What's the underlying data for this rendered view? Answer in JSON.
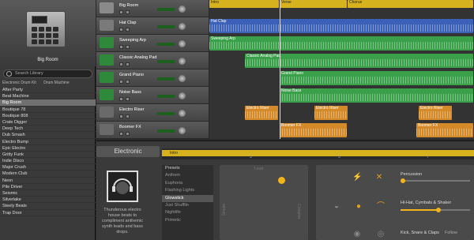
{
  "library": {
    "art_title": "Big Room",
    "search_placeholder": "Search Library",
    "crumbs": [
      "Electronic Drum Kit",
      "Drum Machine"
    ],
    "items": [
      "After Party",
      "Beat Machine",
      "Big Room",
      "Boutique 78",
      "Boutique 808",
      "Crate Digger",
      "Deep Tech",
      "Dub Smash",
      "Electro Bump",
      "Epic Electro",
      "Gritty Funk",
      "Indie Disco",
      "Major Crush",
      "Modern Club",
      "Neon",
      "Pile Driver",
      "Seismic",
      "Silverlake",
      "Steely Beats",
      "Trap Door"
    ],
    "selected": "Big Room"
  },
  "tracks": [
    {
      "name": "Big Room",
      "icon": "drum-machine-icon",
      "color": "#8a8a8a"
    },
    {
      "name": "Hat Clap",
      "icon": "drum-machine-icon",
      "color": "#7a7a7a"
    },
    {
      "name": "Sweeping Arp",
      "icon": "keyboard-icon",
      "color": "#2e8a3a"
    },
    {
      "name": "Classic Analog Pad",
      "icon": "keyboard-icon",
      "color": "#2e8a3a"
    },
    {
      "name": "Grand Piano",
      "icon": "keyboard-icon",
      "color": "#2e8a3a"
    },
    {
      "name": "Noise Bass",
      "icon": "keyboard-icon",
      "color": "#2e8a3a"
    },
    {
      "name": "Electro Riser",
      "icon": "fx-spark-icon",
      "color": "#6a6a6a"
    },
    {
      "name": "Boomer FX",
      "icon": "fx-spark-icon",
      "color": "#6a6a6a"
    }
  ],
  "regions": [
    {
      "label": "Intro",
      "track": 0,
      "start": 0,
      "end": 89,
      "color": "yellow"
    },
    {
      "label": "Verse",
      "track": 0,
      "start": 89,
      "end": 175,
      "color": "yellow"
    },
    {
      "label": "Chorus",
      "track": 0,
      "start": 175,
      "end": 335,
      "color": "yellow"
    },
    {
      "label": "Hat Clap",
      "track": 1,
      "start": 0,
      "end": 335,
      "color": "blue"
    },
    {
      "label": "Sweeping Arp",
      "track": 2,
      "start": 0,
      "end": 335,
      "color": "green"
    },
    {
      "label": "Classic Analog Pad",
      "track": 3,
      "start": 45,
      "end": 335,
      "color": "green"
    },
    {
      "label": "Grand Piano",
      "track": 4,
      "start": 89,
      "end": 335,
      "color": "green"
    },
    {
      "label": "Noise Bass",
      "track": 5,
      "start": 89,
      "end": 335,
      "color": "green"
    },
    {
      "label": "Electro Riser",
      "track": 6,
      "start": 45,
      "end": 88,
      "color": "orange"
    },
    {
      "label": "Electro Riser",
      "track": 6,
      "start": 133,
      "end": 176,
      "color": "orange"
    },
    {
      "label": "Electro Riser",
      "track": 6,
      "start": 265,
      "end": 308,
      "color": "orange"
    },
    {
      "label": "Boomer FX",
      "track": 7,
      "start": 89,
      "end": 175,
      "color": "orange"
    },
    {
      "label": "Boomer FX",
      "track": 7,
      "start": 262,
      "end": 335,
      "color": "orange"
    }
  ],
  "ruler_marks": [
    "5",
    "9",
    "13",
    "17"
  ],
  "drummer": {
    "genre": "Electronic",
    "description": "Thunderous electro house beats to compliment anthemic synth leads and bass drops."
  },
  "editor": {
    "region_label": "Intro",
    "bar_marks": [
      "3",
      "5",
      "7"
    ],
    "presets_header": "Presets",
    "presets": [
      "Anthem",
      "Euphoria",
      "Flashing Lights",
      "Glowstick",
      "Just Shufflin",
      "Nightlife",
      "Primetic"
    ],
    "selected_preset": "Glowstick",
    "xy": {
      "top_label": "Loud",
      "left_label": "Simple",
      "right_label": "Complex",
      "complexity": 0.75,
      "loudness": 0.2
    },
    "percussion": {
      "label": "Percussion",
      "level": 0.05
    },
    "hihat": {
      "label": "Hi-Hat, Cymbals & Shaker",
      "level": 0.55
    },
    "kick": {
      "label": "Kick, Snare & Claps",
      "follow_label": "Follow"
    }
  }
}
